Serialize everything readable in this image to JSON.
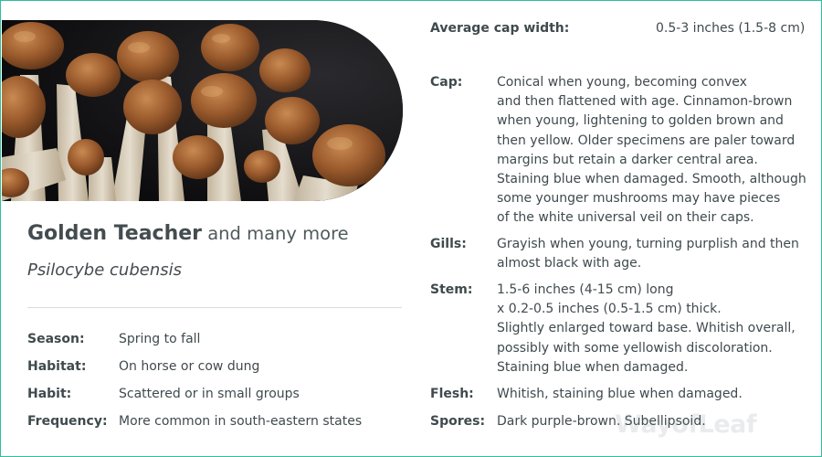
{
  "header": {
    "title_strong": "Golden Teacher",
    "title_rest": " and many more",
    "scientific_name": "Psilocybe cubensis"
  },
  "left_facts": [
    {
      "key": "Season:",
      "value": "Spring to fall"
    },
    {
      "key": "Habitat:",
      "value": "On horse or cow dung"
    },
    {
      "key": "Habit:",
      "value": "Scattered or in small groups"
    },
    {
      "key": "Frequency:",
      "value": "More common in south-eastern states"
    }
  ],
  "average_cap_width": {
    "key": "Average cap width:",
    "value": "0.5-3 inches (1.5-8 cm)"
  },
  "details": {
    "cap": {
      "key": "Cap:",
      "lines": [
        "Conical when young, becoming convex",
        "and then flattened with age. Cinnamon-brown",
        "when young, lightening to golden brown and",
        "then yellow. Older specimens are paler toward",
        "margins but retain a darker central area.",
        "Staining blue when damaged. Smooth, although",
        "some younger mushrooms may have pieces",
        "of the white universal veil on their caps."
      ]
    },
    "gills": {
      "key": "Gills:",
      "lines": [
        "Grayish when young, turning purplish and then",
        "almost black with age."
      ]
    },
    "stem": {
      "key": "Stem:",
      "lines": [
        "1.5-6 inches (4-15 cm) long",
        "x 0.2-0.5 inches (0.5-1.5 cm) thick.",
        "Slightly enlarged toward base. Whitish overall,",
        "possibly with some yellowish discoloration.",
        "Staining blue when damaged."
      ]
    },
    "flesh": {
      "key": "Flesh:",
      "lines": [
        "Whitish, staining blue when damaged."
      ]
    },
    "spores": {
      "key": "Spores:",
      "lines": [
        "Dark purple-brown. Subellipsoid."
      ]
    }
  },
  "watermark": "WayofLeaf",
  "colors": {
    "border": "#2fbf9b",
    "text": "#3f4a4d",
    "divider": "#d9dcdd",
    "photo_bg": "#151517"
  }
}
